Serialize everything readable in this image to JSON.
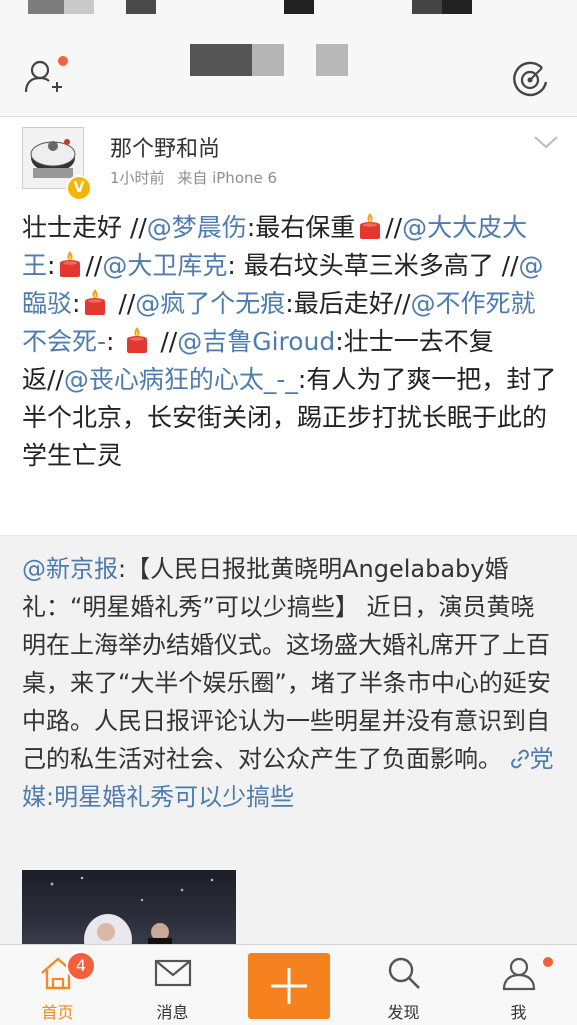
{
  "post": {
    "username": "那个野和尚",
    "time": "1小时前",
    "source": "来自 iPhone 6",
    "segments": [
      {
        "t": "text",
        "v": "壮士走好 //"
      },
      {
        "t": "at",
        "v": "@梦晨伤"
      },
      {
        "t": "text",
        "v": ":最右保重"
      },
      {
        "t": "emoji",
        "v": "candle"
      },
      {
        "t": "text",
        "v": "//"
      },
      {
        "t": "at",
        "v": "@大大皮大王"
      },
      {
        "t": "text",
        "v": ":"
      },
      {
        "t": "emoji",
        "v": "candle"
      },
      {
        "t": "text",
        "v": "//"
      },
      {
        "t": "at",
        "v": "@大卫库克"
      },
      {
        "t": "text",
        "v": ": 最右坟头草三米多高了 //"
      },
      {
        "t": "at",
        "v": "@臨驳"
      },
      {
        "t": "text",
        "v": ":"
      },
      {
        "t": "emoji",
        "v": "candle"
      },
      {
        "t": "text",
        "v": " //"
      },
      {
        "t": "at",
        "v": "@疯了个无痕"
      },
      {
        "t": "text",
        "v": ":最后走好//"
      },
      {
        "t": "at",
        "v": "@不作死就不会死-"
      },
      {
        "t": "text",
        "v": ": "
      },
      {
        "t": "emoji",
        "v": "candle"
      },
      {
        "t": "text",
        "v": " //"
      },
      {
        "t": "at",
        "v": "@吉鲁Giroud"
      },
      {
        "t": "text",
        "v": ":壮士一去不复返//"
      },
      {
        "t": "at",
        "v": "@丧心病狂的心太_-_"
      },
      {
        "t": "text",
        "v": ":有人为了爽一把，封了半个北京，长安街关闭，踢正步打扰长眠于此的学生亡灵"
      }
    ]
  },
  "repost": {
    "segments": [
      {
        "t": "at",
        "v": "@新京报"
      },
      {
        "t": "text",
        "v": ":【人民日报批黄晓明Angelababy婚礼：“明星婚礼秀”可以少搞些】 近日，演员黄晓明在上海举办结婚仪式。这场盛大婚礼席开了上百桌，来了“大半个娱乐圈”，堵了半条市中心的延安中路。人民日报评论认为一些明星并没有意识到自己的私生活对社会、对公众产生了负面影响。 "
      },
      {
        "t": "link",
        "v": "党媒:明星婚礼秀可以少搞些"
      }
    ]
  },
  "tabbar": {
    "home": {
      "label": "首页",
      "badge": "4"
    },
    "messages": {
      "label": "消息"
    },
    "discover": {
      "label": "发现"
    },
    "me": {
      "label": "我"
    }
  },
  "colors": {
    "accent": "#f5811f",
    "link": "#4f7cae",
    "badge": "#f55f3c",
    "verified": "#f7b500"
  }
}
